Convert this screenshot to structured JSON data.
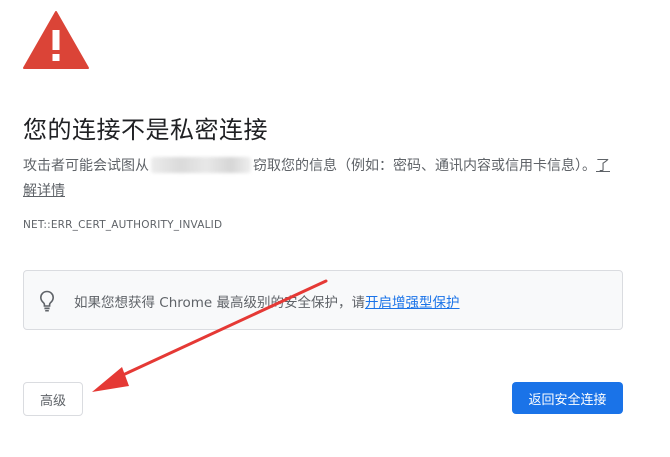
{
  "page": {
    "title": "您的连接不是私密连接",
    "description_prefix": "攻击者可能会试图从",
    "description_suffix": "窃取您的信息（例如：密码、通讯内容或信用卡信息）。",
    "learn_more_link": "了解详情",
    "error_code": "NET::ERR_CERT_AUTHORITY_INVALID"
  },
  "enhanced_protection": {
    "text": "如果您想获得 Chrome 最高级别的安全保护，请",
    "link": "开启增强型保护"
  },
  "buttons": {
    "advanced": "高级",
    "back_to_safety": "返回安全连接"
  },
  "colors": {
    "warning_red": "#db4437",
    "primary_blue": "#1a73e8",
    "annotation_arrow": "#e53935"
  },
  "icons": {
    "warning": "warning-triangle-icon",
    "lightbulb": "lightbulb-icon"
  }
}
